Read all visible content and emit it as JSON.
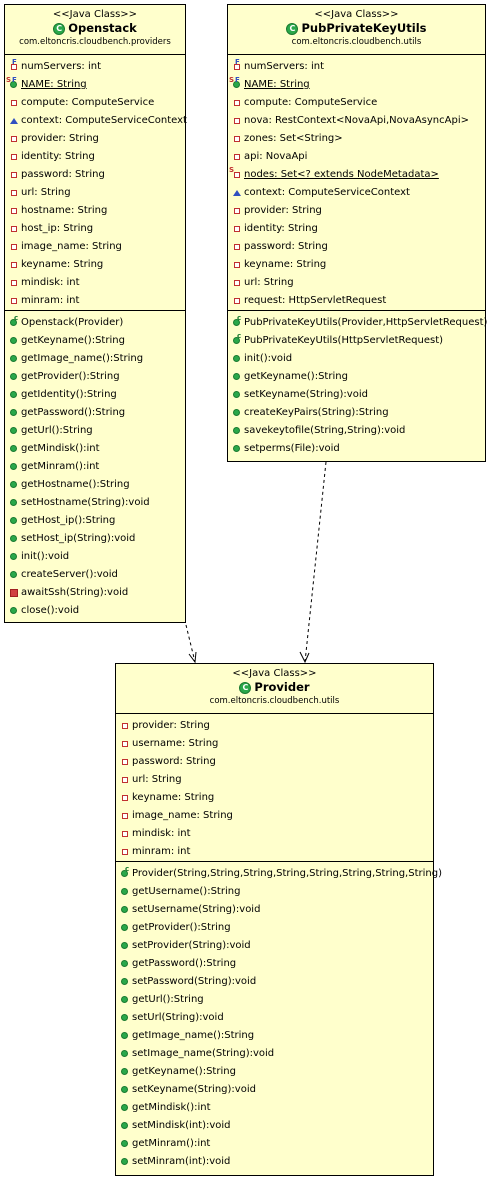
{
  "classes": [
    {
      "id": "openstack",
      "stereotype": "<<Java Class>>",
      "name": "Openstack",
      "package": "com.eltoncris.cloudbench.providers",
      "fields": [
        {
          "text": "numServers: int",
          "icon": "private-static-final",
          "underline": false
        },
        {
          "text": "NAME: String",
          "icon": "public-static-final",
          "underline": true
        },
        {
          "text": "compute: ComputeService",
          "icon": "private",
          "underline": false
        },
        {
          "text": "context: ComputeServiceContext",
          "icon": "protected",
          "underline": false
        },
        {
          "text": "provider: String",
          "icon": "private",
          "underline": false
        },
        {
          "text": "identity: String",
          "icon": "private",
          "underline": false
        },
        {
          "text": "password: String",
          "icon": "private",
          "underline": false
        },
        {
          "text": "url: String",
          "icon": "private",
          "underline": false
        },
        {
          "text": "hostname: String",
          "icon": "private",
          "underline": false
        },
        {
          "text": "host_ip: String",
          "icon": "private",
          "underline": false
        },
        {
          "text": "image_name: String",
          "icon": "private",
          "underline": false
        },
        {
          "text": "keyname: String",
          "icon": "private",
          "underline": false
        },
        {
          "text": "mindisk: int",
          "icon": "private",
          "underline": false
        },
        {
          "text": "minram: int",
          "icon": "private",
          "underline": false
        }
      ],
      "methods": [
        {
          "text": "Openstack(Provider)",
          "icon": "constructor"
        },
        {
          "text": "getKeyname():String",
          "icon": "public"
        },
        {
          "text": "getImage_name():String",
          "icon": "public"
        },
        {
          "text": "getProvider():String",
          "icon": "public"
        },
        {
          "text": "getIdentity():String",
          "icon": "public"
        },
        {
          "text": "getPassword():String",
          "icon": "public"
        },
        {
          "text": "getUrl():String",
          "icon": "public"
        },
        {
          "text": "getMindisk():int",
          "icon": "public"
        },
        {
          "text": "getMinram():int",
          "icon": "public"
        },
        {
          "text": "getHostname():String",
          "icon": "public"
        },
        {
          "text": "setHostname(String):void",
          "icon": "public"
        },
        {
          "text": "getHost_ip():String",
          "icon": "public"
        },
        {
          "text": "setHost_ip(String):void",
          "icon": "public"
        },
        {
          "text": "init():void",
          "icon": "public"
        },
        {
          "text": "createServer():void",
          "icon": "public"
        },
        {
          "text": "awaitSsh(String):void",
          "icon": "private-method"
        },
        {
          "text": "close():void",
          "icon": "public"
        }
      ]
    },
    {
      "id": "pubprivatekeyutils",
      "stereotype": "<<Java Class>>",
      "name": "PubPrivateKeyUtils",
      "package": "com.eltoncris.cloudbench.utils",
      "fields": [
        {
          "text": "numServers: int",
          "icon": "private-static-final",
          "underline": false
        },
        {
          "text": "NAME: String",
          "icon": "public-static-final",
          "underline": true
        },
        {
          "text": "compute: ComputeService",
          "icon": "private",
          "underline": false
        },
        {
          "text": "nova: RestContext<NovaApi,NovaAsyncApi>",
          "icon": "private",
          "underline": false
        },
        {
          "text": "zones: Set<String>",
          "icon": "private",
          "underline": false
        },
        {
          "text": "api: NovaApi",
          "icon": "private",
          "underline": false
        },
        {
          "text": "nodes: Set<? extends NodeMetadata>",
          "icon": "private-static",
          "underline": true
        },
        {
          "text": "context: ComputeServiceContext",
          "icon": "protected",
          "underline": false
        },
        {
          "text": "provider: String",
          "icon": "private",
          "underline": false
        },
        {
          "text": "identity: String",
          "icon": "private",
          "underline": false
        },
        {
          "text": "password: String",
          "icon": "private",
          "underline": false
        },
        {
          "text": "keyname: String",
          "icon": "private",
          "underline": false
        },
        {
          "text": "url: String",
          "icon": "private",
          "underline": false
        },
        {
          "text": "request: HttpServletRequest",
          "icon": "private",
          "underline": false
        }
      ],
      "methods": [
        {
          "text": "PubPrivateKeyUtils(Provider,HttpServletRequest)",
          "icon": "constructor"
        },
        {
          "text": "PubPrivateKeyUtils(HttpServletRequest)",
          "icon": "constructor"
        },
        {
          "text": "init():void",
          "icon": "public"
        },
        {
          "text": "getKeyname():String",
          "icon": "public"
        },
        {
          "text": "setKeyname(String):void",
          "icon": "public"
        },
        {
          "text": "createKeyPairs(String):String",
          "icon": "public"
        },
        {
          "text": "savekeytofile(String,String):void",
          "icon": "public"
        },
        {
          "text": "setperms(File):void",
          "icon": "public"
        }
      ]
    },
    {
      "id": "provider",
      "stereotype": "<<Java Class>>",
      "name": "Provider",
      "package": "com.eltoncris.cloudbench.utils",
      "fields": [
        {
          "text": "provider: String",
          "icon": "private",
          "underline": false
        },
        {
          "text": "username: String",
          "icon": "private",
          "underline": false
        },
        {
          "text": "password: String",
          "icon": "private",
          "underline": false
        },
        {
          "text": "url: String",
          "icon": "private",
          "underline": false
        },
        {
          "text": "keyname: String",
          "icon": "private",
          "underline": false
        },
        {
          "text": "image_name: String",
          "icon": "private",
          "underline": false
        },
        {
          "text": "mindisk: int",
          "icon": "private",
          "underline": false
        },
        {
          "text": "minram: int",
          "icon": "private",
          "underline": false
        }
      ],
      "methods": [
        {
          "text": "Provider(String,String,String,String,String,String,String,String)",
          "icon": "constructor"
        },
        {
          "text": "getUsername():String",
          "icon": "public"
        },
        {
          "text": "setUsername(String):void",
          "icon": "public"
        },
        {
          "text": "getProvider():String",
          "icon": "public"
        },
        {
          "text": "setProvider(String):void",
          "icon": "public"
        },
        {
          "text": "getPassword():String",
          "icon": "public"
        },
        {
          "text": "setPassword(String):void",
          "icon": "public"
        },
        {
          "text": "getUrl():String",
          "icon": "public"
        },
        {
          "text": "setUrl(String):void",
          "icon": "public"
        },
        {
          "text": "getImage_name():String",
          "icon": "public"
        },
        {
          "text": "setImage_name(String):void",
          "icon": "public"
        },
        {
          "text": "getKeyname():String",
          "icon": "public"
        },
        {
          "text": "setKeyname(String):void",
          "icon": "public"
        },
        {
          "text": "getMindisk():int",
          "icon": "public"
        },
        {
          "text": "setMindisk(int):void",
          "icon": "public"
        },
        {
          "text": "getMinram():int",
          "icon": "public"
        },
        {
          "text": "setMinram(int):void",
          "icon": "public"
        }
      ]
    }
  ],
  "dependencies": [
    {
      "from": "openstack",
      "to": "provider",
      "style": "dashed"
    },
    {
      "from": "pubprivatekeyutils",
      "to": "provider",
      "style": "dashed"
    }
  ],
  "colors": {
    "class_fill": "#ffffcc",
    "border": "#000000",
    "class_icon": "#2aa84a"
  }
}
